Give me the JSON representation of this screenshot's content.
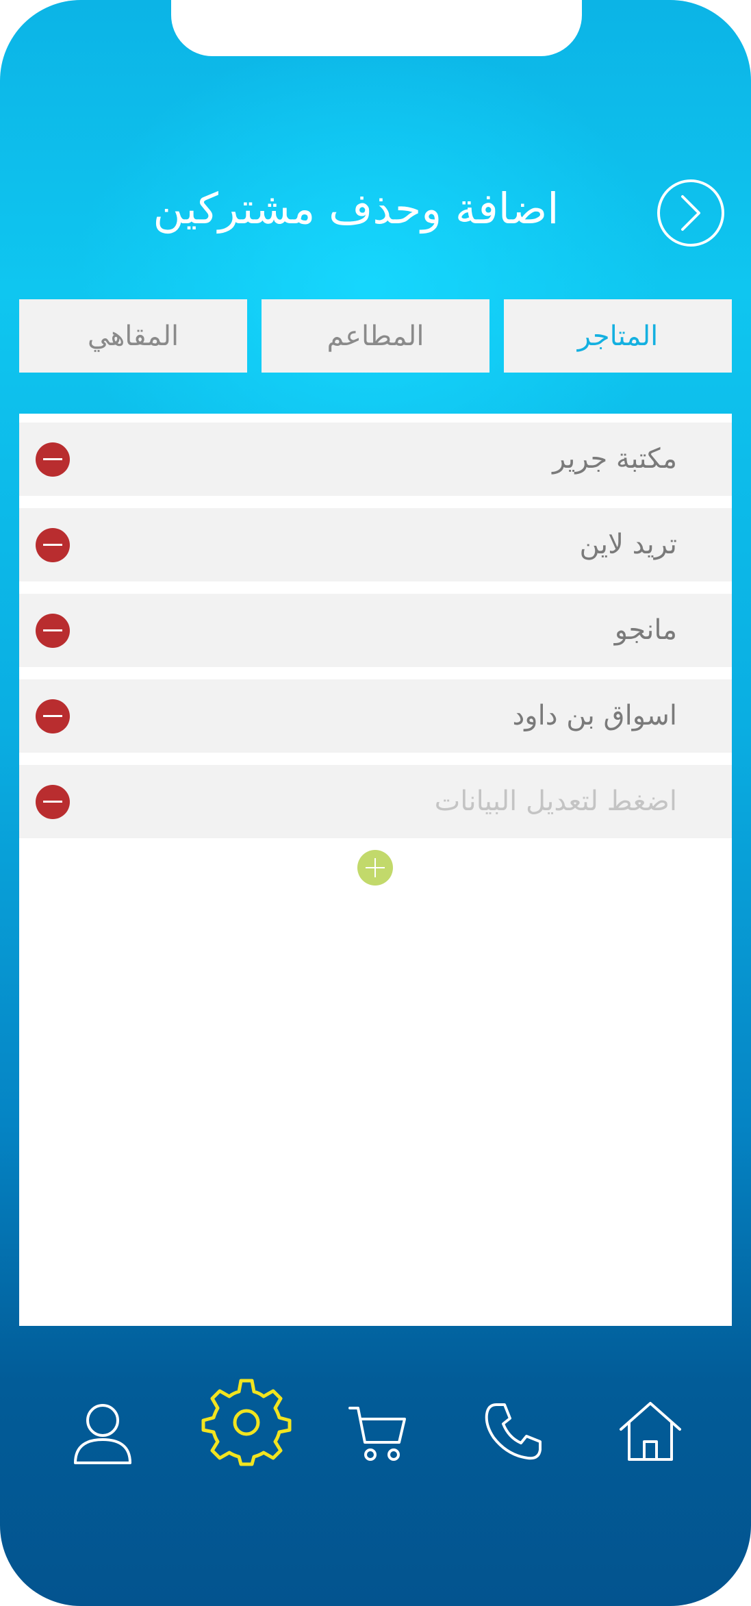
{
  "header": {
    "title": "اضافة وحذف مشتركين",
    "back_icon": "chevron-right-circle-icon"
  },
  "tabs": [
    {
      "label": "المتاجر",
      "active": true
    },
    {
      "label": "المطاعم",
      "active": false
    },
    {
      "label": "المقاهي",
      "active": false
    }
  ],
  "list": {
    "items": [
      {
        "label": "مكتبة جرير"
      },
      {
        "label": "تريد لاين"
      },
      {
        "label": "مانجو"
      },
      {
        "label": "اسواق بن داود"
      }
    ],
    "placeholder_row": "اضغط لتعديل البيانات",
    "remove_icon": "minus-circle-icon",
    "add_icon": "plus-circle-icon"
  },
  "bottom_nav": [
    {
      "icon": "home-icon",
      "active": false
    },
    {
      "icon": "phone-icon",
      "active": false
    },
    {
      "icon": "cart-icon",
      "active": false
    },
    {
      "icon": "gear-icon",
      "active": true
    },
    {
      "icon": "user-icon",
      "active": false
    }
  ],
  "colors": {
    "active_tab": "#14b0e0",
    "remove": "#b92d2f",
    "add": "#c2d96b",
    "active_nav": "#f2e41f"
  }
}
